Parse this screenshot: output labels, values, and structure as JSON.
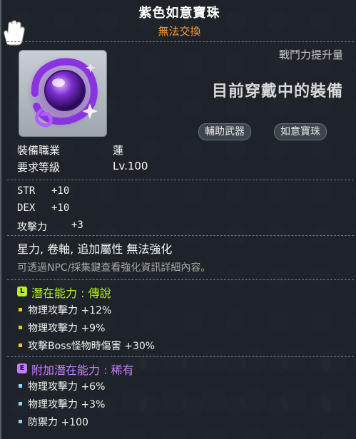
{
  "item": {
    "name": "紫色如意寶珠",
    "trade": "無法交換",
    "combat_power": "戰鬥力提升量",
    "currently_equipped": "目前穿戴中的裝備",
    "tags": [
      "輔助武器",
      "如意寶珠"
    ],
    "job_label": "裝備職業",
    "job_value": "蓮",
    "level_label": "要求等級",
    "level_value": "Lv.100"
  },
  "stats": [
    {
      "name": "STR",
      "value": "+10"
    },
    {
      "name": "DEX",
      "value": "+10"
    },
    {
      "name": "攻擊力",
      "value": "+3"
    }
  ],
  "notes": {
    "line1": "星力, 卷軸, 追加屬性 無法強化",
    "line2": "可透過NPC/採集鍵查看強化資訊詳細內容。"
  },
  "potential": {
    "badge": "L",
    "label": "潛在能力 : 傳說",
    "color": "#b8f020",
    "lines": [
      "物理攻擊力 +12%",
      "物理攻擊力 +9%",
      "攻擊Boss怪物時傷害 +30%"
    ]
  },
  "bonus_potential": {
    "badge": "E",
    "label": "附加潛在能力 : 稀有",
    "color": "#c77cff",
    "lines": [
      "物理攻擊力 +6%",
      "物理攻擊力 +3%",
      "防禦力 +100"
    ]
  },
  "icons": {
    "cursor": "white-glove-cursor-icon",
    "item": "purple-orb-icon"
  }
}
